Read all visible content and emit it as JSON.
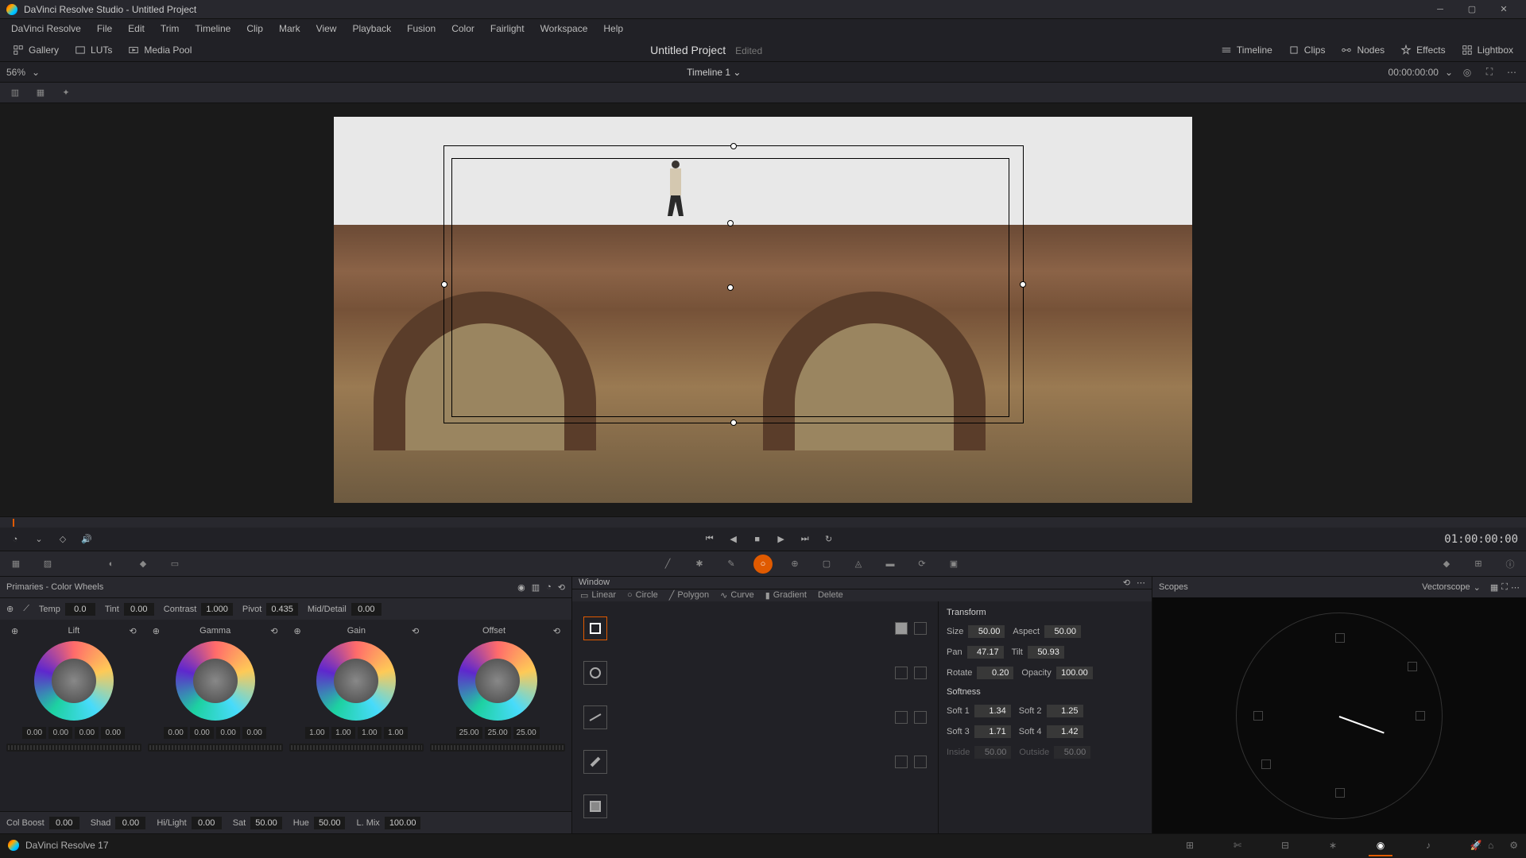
{
  "window": {
    "title": "DaVinci Resolve Studio - Untitled Project"
  },
  "menu": [
    "DaVinci Resolve",
    "File",
    "Edit",
    "Trim",
    "Timeline",
    "Clip",
    "Mark",
    "View",
    "Playback",
    "Fusion",
    "Color",
    "Fairlight",
    "Workspace",
    "Help"
  ],
  "top_toolbar": {
    "left": [
      {
        "id": "gallery",
        "label": "Gallery"
      },
      {
        "id": "luts",
        "label": "LUTs"
      },
      {
        "id": "media-pool",
        "label": "Media Pool"
      }
    ],
    "project": "Untitled Project",
    "edited": "Edited",
    "right": [
      {
        "id": "timeline",
        "label": "Timeline"
      },
      {
        "id": "clips",
        "label": "Clips"
      },
      {
        "id": "nodes",
        "label": "Nodes"
      },
      {
        "id": "effects",
        "label": "Effects"
      },
      {
        "id": "lightbox",
        "label": "Lightbox"
      }
    ]
  },
  "sub_toolbar": {
    "zoom": "56%",
    "timeline_name": "Timeline 1",
    "timecode": "00:00:00:00"
  },
  "transport": {
    "timecode": "01:00:00:00"
  },
  "primaries": {
    "title": "Primaries - Color Wheels",
    "adjustments": {
      "temp": {
        "label": "Temp",
        "value": "0.0"
      },
      "tint": {
        "label": "Tint",
        "value": "0.00"
      },
      "contrast": {
        "label": "Contrast",
        "value": "1.000"
      },
      "pivot": {
        "label": "Pivot",
        "value": "0.435"
      },
      "middetail": {
        "label": "Mid/Detail",
        "value": "0.00"
      }
    },
    "wheels": {
      "lift": {
        "label": "Lift",
        "vals": [
          "0.00",
          "0.00",
          "0.00",
          "0.00"
        ]
      },
      "gamma": {
        "label": "Gamma",
        "vals": [
          "0.00",
          "0.00",
          "0.00",
          "0.00"
        ]
      },
      "gain": {
        "label": "Gain",
        "vals": [
          "1.00",
          "1.00",
          "1.00",
          "1.00"
        ]
      },
      "offset": {
        "label": "Offset",
        "vals": [
          "25.00",
          "25.00",
          "25.00"
        ]
      }
    },
    "bottom": {
      "colboost": {
        "label": "Col Boost",
        "value": "0.00"
      },
      "shad": {
        "label": "Shad",
        "value": "0.00"
      },
      "hilight": {
        "label": "Hi/Light",
        "value": "0.00"
      },
      "sat": {
        "label": "Sat",
        "value": "50.00"
      },
      "hue": {
        "label": "Hue",
        "value": "50.00"
      },
      "lmix": {
        "label": "L. Mix",
        "value": "100.00"
      }
    }
  },
  "window_panel": {
    "title": "Window",
    "tabs": {
      "linear": "Linear",
      "circle": "Circle",
      "polygon": "Polygon",
      "curve": "Curve",
      "gradient": "Gradient",
      "delete": "Delete"
    },
    "transform": {
      "title": "Transform",
      "size": {
        "label": "Size",
        "value": "50.00"
      },
      "aspect": {
        "label": "Aspect",
        "value": "50.00"
      },
      "pan": {
        "label": "Pan",
        "value": "47.17"
      },
      "tilt": {
        "label": "Tilt",
        "value": "50.93"
      },
      "rotate": {
        "label": "Rotate",
        "value": "0.20"
      },
      "opacity": {
        "label": "Opacity",
        "value": "100.00"
      }
    },
    "softness": {
      "title": "Softness",
      "soft1": {
        "label": "Soft 1",
        "value": "1.34"
      },
      "soft2": {
        "label": "Soft 2",
        "value": "1.25"
      },
      "soft3": {
        "label": "Soft 3",
        "value": "1.71"
      },
      "soft4": {
        "label": "Soft 4",
        "value": "1.42"
      },
      "inside": {
        "label": "Inside",
        "value": "50.00"
      },
      "outside": {
        "label": "Outside",
        "value": "50.00"
      }
    }
  },
  "scopes": {
    "title": "Scopes",
    "type": "Vectorscope"
  },
  "status": {
    "app": "DaVinci Resolve 17"
  }
}
